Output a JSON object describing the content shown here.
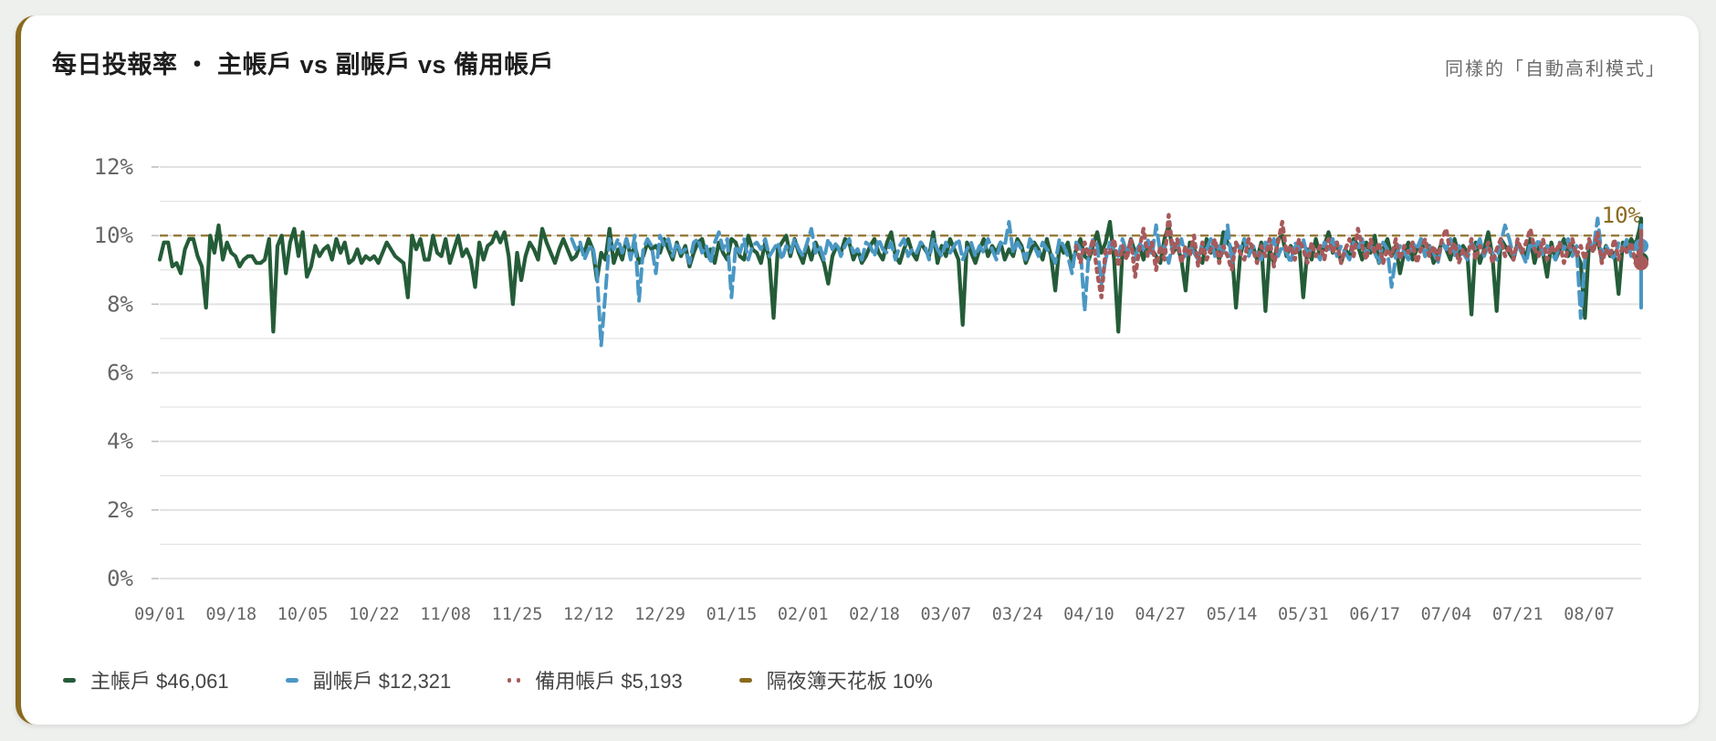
{
  "header": {
    "title": "每日投報率 ・ 主帳戶 vs 副帳戶 vs 備用帳戶",
    "subtitle": "同樣的「自動高利模式」"
  },
  "legend": {
    "items": [
      {
        "label": "主帳戶 $46,061",
        "color": "#245c38",
        "style": "solid"
      },
      {
        "label": "副帳戶 $12,321",
        "color": "#4a97c4",
        "style": "dashed"
      },
      {
        "label": "備用帳戶 $5,193",
        "color": "#a85a5a",
        "style": "dotted"
      },
      {
        "label": "隔夜簿天花板 10%",
        "color": "#8a6a1e",
        "style": "solid"
      }
    ]
  },
  "chart_data": {
    "type": "line",
    "title": "每日投報率 ・ 主帳戶 vs 副帳戶 vs 備用帳戶",
    "xlabel": "",
    "ylabel": "",
    "ylim": [
      0,
      12
    ],
    "yticks": [
      "0%",
      "2%",
      "4%",
      "6%",
      "8%",
      "10%",
      "12%"
    ],
    "xticks": [
      "09/01",
      "09/18",
      "10/05",
      "10/22",
      "11/08",
      "11/25",
      "12/12",
      "12/29",
      "01/15",
      "02/01",
      "02/18",
      "03/07",
      "03/24",
      "04/10",
      "04/27",
      "05/14",
      "05/31",
      "06/17",
      "07/04",
      "07/21",
      "08/07"
    ],
    "ceiling": {
      "value": 10,
      "label": "10%",
      "color": "#8a6a1e"
    },
    "grid": true,
    "legend_position": "bottom",
    "series": [
      {
        "name": "主帳戶 $46,061",
        "color": "#245c38",
        "style": "solid",
        "start_day": 0,
        "values": [
          9.3,
          9.8,
          9.8,
          9.1,
          9.2,
          8.9,
          9.6,
          9.9,
          9.9,
          9.4,
          9.1,
          7.9,
          10.0,
          9.5,
          10.3,
          9.3,
          9.8,
          9.5,
          9.4,
          9.1,
          9.3,
          9.4,
          9.4,
          9.2,
          9.2,
          9.3,
          9.9,
          7.2,
          9.7,
          10.0,
          8.9,
          9.8,
          10.2,
          9.4,
          10.1,
          8.8,
          9.1,
          9.7,
          9.4,
          9.6,
          9.7,
          9.3,
          9.9,
          9.5,
          9.8,
          9.2,
          9.3,
          9.6,
          9.2,
          9.4,
          9.3,
          9.4,
          9.2,
          9.5,
          9.8,
          9.6,
          9.4,
          9.3,
          9.2,
          8.2,
          10.0,
          9.6,
          9.9,
          9.3,
          9.3,
          10.0,
          9.5,
          9.4,
          9.9,
          9.2,
          9.6,
          10.0,
          9.4,
          9.6,
          9.3,
          8.5,
          9.8,
          9.3,
          9.7,
          9.8,
          10.1,
          9.8,
          10.1,
          9.4,
          8.0,
          9.5,
          8.7,
          9.4,
          9.8,
          9.6,
          9.3,
          10.2,
          9.8,
          9.5,
          9.2,
          9.6,
          9.9,
          9.6,
          9.3,
          9.4,
          9.7,
          9.5,
          9.9,
          9.6,
          8.7,
          9.5,
          9.3,
          10.2,
          9.2,
          9.6,
          9.3,
          9.9,
          9.4,
          9.7,
          9.2,
          9.4,
          9.8,
          9.6,
          9.7,
          9.5,
          9.9,
          9.6,
          9.3,
          9.8,
          9.4,
          9.7,
          9.1,
          9.5,
          9.8,
          9.9,
          9.4,
          9.6,
          9.2,
          9.8,
          9.5,
          9.3,
          9.9,
          9.8,
          9.4,
          9.3,
          10.0,
          9.6,
          9.5,
          9.2,
          9.8,
          9.3,
          7.6,
          9.6,
          9.8,
          10.0,
          9.4,
          9.9,
          9.5,
          9.2,
          9.7,
          9.3,
          9.8,
          9.5,
          9.2,
          8.6,
          9.4,
          9.7,
          9.5,
          9.9,
          9.8,
          9.3,
          9.6,
          9.2,
          9.4,
          9.7,
          9.9,
          9.5,
          9.3,
          9.8,
          10.1,
          9.4,
          9.2,
          9.6,
          9.9,
          9.5,
          9.3,
          9.8,
          9.6,
          9.4,
          10.1,
          9.2,
          9.7,
          9.4,
          9.9,
          9.6,
          9.3,
          7.4,
          9.8,
          9.5,
          9.2,
          9.6,
          9.9,
          9.4,
          9.7,
          9.5,
          9.8,
          9.3,
          9.6,
          9.4,
          9.9,
          9.7,
          9.2,
          9.5,
          9.8,
          9.6,
          9.3,
          9.9,
          9.4,
          8.4,
          9.7,
          9.5,
          9.8,
          9.2,
          9.6,
          9.9,
          9.4,
          9.3,
          9.7,
          10.1,
          9.5,
          9.8,
          10.4,
          9.3,
          7.2,
          9.6,
          9.4,
          9.9,
          9.5,
          9.7,
          9.3,
          9.8,
          9.6,
          9.4,
          9.2,
          9.9,
          10.3,
          9.5,
          9.7,
          9.3,
          8.4,
          9.8,
          9.6,
          9.4,
          9.2,
          9.9,
          9.5,
          9.7,
          9.3,
          10.1,
          9.8,
          9.6,
          7.9,
          9.4,
          9.9,
          9.5,
          9.7,
          9.3,
          9.8,
          7.8,
          9.6,
          9.2,
          9.9,
          10.0,
          9.4,
          9.7,
          9.5,
          9.8,
          8.2,
          9.6,
          9.3,
          9.9,
          9.4,
          9.7,
          10.1,
          9.5,
          9.8,
          9.2,
          9.6,
          9.4,
          9.9,
          9.7,
          9.3,
          9.8,
          9.5,
          10.0,
          9.2,
          9.6,
          9.9,
          9.4,
          9.7,
          8.9,
          9.5,
          9.8,
          9.3,
          9.6,
          9.9,
          9.4,
          9.7,
          9.2,
          9.5,
          9.8,
          9.6,
          9.3,
          9.9,
          9.4,
          9.7,
          9.5,
          7.7,
          9.8,
          9.2,
          9.6,
          10.1,
          9.4,
          7.8,
          9.9,
          9.7,
          9.5,
          9.3,
          9.8,
          9.6,
          9.4,
          9.9,
          9.2,
          9.7,
          9.5,
          8.8,
          9.8,
          9.3,
          9.6,
          9.9,
          9.4,
          9.7,
          9.5,
          9.2,
          7.6,
          9.8,
          9.6,
          9.9,
          9.3,
          9.7,
          9.4,
          9.5,
          8.3,
          9.8,
          9.6,
          9.9,
          9.7,
          10.2,
          10.5,
          9.8,
          9.3
        ]
      },
      {
        "name": "副帳戶 $12,321",
        "color": "#4a97c4",
        "style": "dashed",
        "start_day": 98,
        "values": [
          9.9,
          9.6,
          9.8,
          9.3,
          9.6,
          9.7,
          8.9,
          6.8,
          8.3,
          9.9,
          9.6,
          9.9,
          9.5,
          9.9,
          9.3,
          10.0,
          8.1,
          9.6,
          9.9,
          9.7,
          8.9,
          10.0,
          9.7,
          9.9,
          9.4,
          9.8,
          9.5,
          9.6,
          9.2,
          9.8,
          9.9,
          9.5,
          9.7,
          9.2,
          9.8,
          10.1,
          9.6,
          9.9,
          8.2,
          9.7,
          9.5,
          9.9,
          9.3,
          9.7,
          9.8,
          9.6,
          9.9,
          9.4,
          9.6,
          9.8,
          9.3,
          9.7,
          9.5,
          9.9,
          9.6,
          9.4,
          9.8,
          10.2,
          9.5,
          9.7,
          9.3,
          9.9,
          9.6,
          9.8,
          9.4,
          9.7,
          9.9,
          9.5,
          9.6,
          9.3,
          9.8,
          9.7,
          9.4,
          9.9,
          9.6,
          9.5,
          9.8,
          9.3,
          9.7,
          9.9,
          9.4,
          9.6,
          9.5,
          9.8,
          9.7,
          9.3,
          9.9,
          9.6,
          9.4,
          9.8,
          9.5,
          9.7,
          9.9,
          9.3,
          9.6,
          9.8,
          9.4,
          9.7,
          9.5,
          9.9,
          9.6,
          9.3,
          9.8,
          9.7,
          10.4,
          9.5,
          9.8,
          9.6,
          9.3,
          9.9,
          9.7,
          9.4,
          9.8,
          9.6,
          9.5,
          9.2,
          9.9,
          9.7,
          9.4,
          8.9,
          9.8,
          9.6,
          7.8,
          9.5,
          9.9,
          9.7,
          8.6,
          9.3,
          9.8,
          9.6,
          9.4,
          9.9,
          9.5,
          9.7,
          9.3,
          9.8,
          9.6,
          9.9,
          9.4,
          10.3,
          9.5,
          9.7,
          9.2,
          9.8,
          9.6,
          9.9,
          9.4,
          9.7,
          9.5,
          9.3,
          9.8,
          9.6,
          9.9,
          9.4,
          9.7,
          9.5,
          10.3,
          9.2,
          9.8,
          9.6,
          9.9,
          9.4,
          9.7,
          9.5,
          9.3,
          9.8,
          9.6,
          9.9,
          9.4,
          9.7,
          9.5,
          9.2,
          9.8,
          9.6,
          9.9,
          9.4,
          9.7,
          9.5,
          9.3,
          9.8,
          9.6,
          9.9,
          9.4,
          9.7,
          9.5,
          9.3,
          9.8,
          9.6,
          9.9,
          9.4,
          9.7,
          9.5,
          9.2,
          9.8,
          9.6,
          8.5,
          9.4,
          9.7,
          9.5,
          9.3,
          9.8,
          9.6,
          9.9,
          9.4,
          9.7,
          9.5,
          9.2,
          9.8,
          9.6,
          9.9,
          9.4,
          9.7,
          9.5,
          9.3,
          9.8,
          9.6,
          9.9,
          9.4,
          9.7,
          9.5,
          9.3,
          9.8,
          10.3,
          9.9,
          9.4,
          9.7,
          9.5,
          9.2,
          9.8,
          9.6,
          9.9,
          9.4,
          9.7,
          9.5,
          9.3,
          9.8,
          9.6,
          9.9,
          9.4,
          9.7,
          7.6,
          9.3,
          9.8,
          9.6,
          10.5,
          9.4,
          9.7,
          9.5,
          9.3,
          9.8,
          9.6,
          9.9,
          9.4,
          9.7,
          9.5,
          9.2,
          9.8,
          9.6,
          9.9,
          9.4,
          9.7,
          9.5,
          9.3,
          9.8,
          9.6,
          10.2,
          9.4,
          9.7,
          9.5,
          9.3,
          9.8,
          9.6,
          9.9,
          9.4,
          9.7,
          9.5,
          9.2,
          9.8,
          9.6,
          9.9,
          9.4,
          9.7,
          9.5,
          9.3,
          9.8,
          9.6,
          9.9,
          9.4,
          9.7,
          9.5,
          9.3,
          9.8,
          9.6,
          8.1,
          9.4,
          9.7,
          9.5,
          9.2,
          9.8,
          9.6,
          9.9,
          9.4,
          9.7,
          9.5,
          9.3,
          9.8,
          9.6,
          9.9,
          9.4,
          9.7,
          9.5,
          9.3,
          9.8,
          10.3,
          7.9,
          9.4,
          9.7,
          9.5,
          9.2,
          9.8,
          9.6,
          9.9,
          9.4,
          10.2,
          9.5,
          9.3,
          9.8,
          9.6,
          9.9,
          9.4,
          9.7,
          9.5,
          8.8,
          9.7
        ]
      },
      {
        "name": "備用帳戶 $5,193",
        "color": "#a85a5a",
        "style": "dotted",
        "start_day": 218,
        "values": [
          9.7,
          9.2,
          9.8,
          9.4,
          9.9,
          8.9,
          8.2,
          9.6,
          9.5,
          9.9,
          9.1,
          9.7,
          9.3,
          9.9,
          8.8,
          9.6,
          10.2,
          9.4,
          9.8,
          9.0,
          9.7,
          9.3,
          10.6,
          9.5,
          9.9,
          9.2,
          9.7,
          9.4,
          10.0,
          9.1,
          9.8,
          9.3,
          9.6,
          9.9,
          9.2,
          9.7,
          9.4,
          9.0,
          9.8,
          9.5,
          9.3,
          9.9,
          9.6,
          9.2,
          9.7,
          9.4,
          9.9,
          9.1,
          9.8,
          10.4,
          9.5,
          9.7,
          9.3,
          9.9,
          9.6,
          9.2,
          9.8,
          9.4,
          9.7,
          9.3,
          9.9,
          9.5,
          9.8,
          9.2,
          9.6,
          9.9,
          9.4,
          10.2,
          9.7,
          9.3,
          9.9,
          9.5,
          9.8,
          9.2,
          9.6,
          9.4,
          9.9,
          9.3,
          9.7,
          9.5,
          9.8,
          9.2,
          9.6,
          9.9,
          9.4,
          9.7,
          9.3,
          9.9,
          10.2,
          9.5,
          9.8,
          9.2,
          9.6,
          9.4,
          9.9,
          9.3,
          9.7,
          9.5,
          9.8,
          9.2,
          9.6,
          9.9,
          9.4,
          9.7,
          9.3,
          9.9,
          9.5,
          9.8,
          10.2,
          9.6,
          9.4,
          9.9,
          9.3,
          9.7,
          9.5,
          9.8,
          9.2,
          9.6,
          9.9,
          9.4,
          9.7,
          9.3,
          9.9,
          9.5,
          10.1,
          9.2,
          9.6,
          9.4,
          9.9,
          9.3,
          9.7,
          9.5,
          9.8,
          9.2,
          9.6,
          9.9,
          9.4,
          9.7,
          9.3,
          9.9,
          9.5,
          9.8,
          9.2,
          9.6,
          9.4,
          10.2,
          9.3,
          9.7,
          9.5,
          9.8,
          9.2,
          9.6,
          9.9,
          9.4,
          9.7,
          9.3,
          9.9,
          9.5,
          9.8,
          9.2,
          9.6,
          10.2,
          9.9,
          9.3,
          9.7,
          9.5,
          9.8,
          9.2,
          9.6,
          9.9,
          9.4,
          9.7,
          9.3,
          9.9,
          9.5,
          9.8,
          9.2,
          9.6,
          9.4,
          9.3,
          9.2
        ]
      }
    ]
  }
}
